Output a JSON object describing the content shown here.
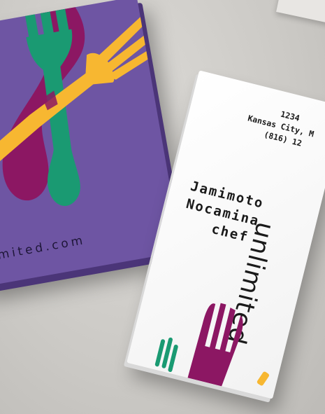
{
  "scene": {
    "description_colors": {
      "surface": "#cfcdc9",
      "purple_card": "#6e55a3",
      "green_fork": "#1a9a72",
      "yellow_fork": "#f7b731",
      "magenta_fork": "#8c1763",
      "white_card": "#ffffff"
    }
  },
  "purple_card": {
    "brand_fragment": "mited.com"
  },
  "white_card": {
    "address_line1": "1234",
    "address_line2": "Kansas City, M",
    "address_line3": "(816) 12",
    "name_line1": "Jamimoto",
    "name_line2": "Nocamina",
    "title": "chef",
    "brand_vertical": "unlimited"
  },
  "icons": {
    "forks": [
      "green-fork-icon",
      "yellow-fork-icon",
      "magenta-fork-icon"
    ]
  }
}
